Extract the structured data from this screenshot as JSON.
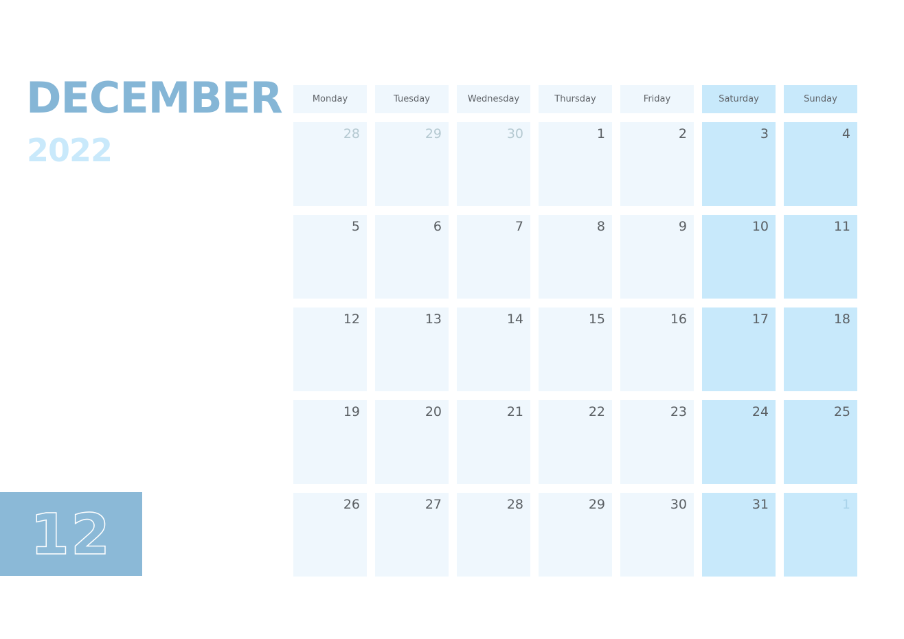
{
  "header": {
    "month": "DECEMBER",
    "year": "2022",
    "month_number": "12"
  },
  "colors": {
    "month_title": "#85b6d6",
    "year_title": "#c9e9fb",
    "month_block": "#8bb9d7",
    "weekday_cell": "#eff7fd",
    "weekend_cell": "#c8e9fb"
  },
  "weekdays": [
    "Monday",
    "Tuesday",
    "Wednesday",
    "Thursday",
    "Friday",
    "Saturday",
    "Sunday"
  ],
  "weeks": [
    [
      {
        "d": "28",
        "muted": true
      },
      {
        "d": "29",
        "muted": true
      },
      {
        "d": "30",
        "muted": true
      },
      {
        "d": "1"
      },
      {
        "d": "2"
      },
      {
        "d": "3"
      },
      {
        "d": "4"
      }
    ],
    [
      {
        "d": "5"
      },
      {
        "d": "6"
      },
      {
        "d": "7"
      },
      {
        "d": "8"
      },
      {
        "d": "9"
      },
      {
        "d": "10"
      },
      {
        "d": "11"
      }
    ],
    [
      {
        "d": "12"
      },
      {
        "d": "13"
      },
      {
        "d": "14"
      },
      {
        "d": "15"
      },
      {
        "d": "16"
      },
      {
        "d": "17"
      },
      {
        "d": "18"
      }
    ],
    [
      {
        "d": "19"
      },
      {
        "d": "20"
      },
      {
        "d": "21"
      },
      {
        "d": "22"
      },
      {
        "d": "23"
      },
      {
        "d": "24"
      },
      {
        "d": "25"
      }
    ],
    [
      {
        "d": "26"
      },
      {
        "d": "27"
      },
      {
        "d": "28"
      },
      {
        "d": "29"
      },
      {
        "d": "30"
      },
      {
        "d": "31"
      },
      {
        "d": "1",
        "muted": true
      }
    ]
  ]
}
